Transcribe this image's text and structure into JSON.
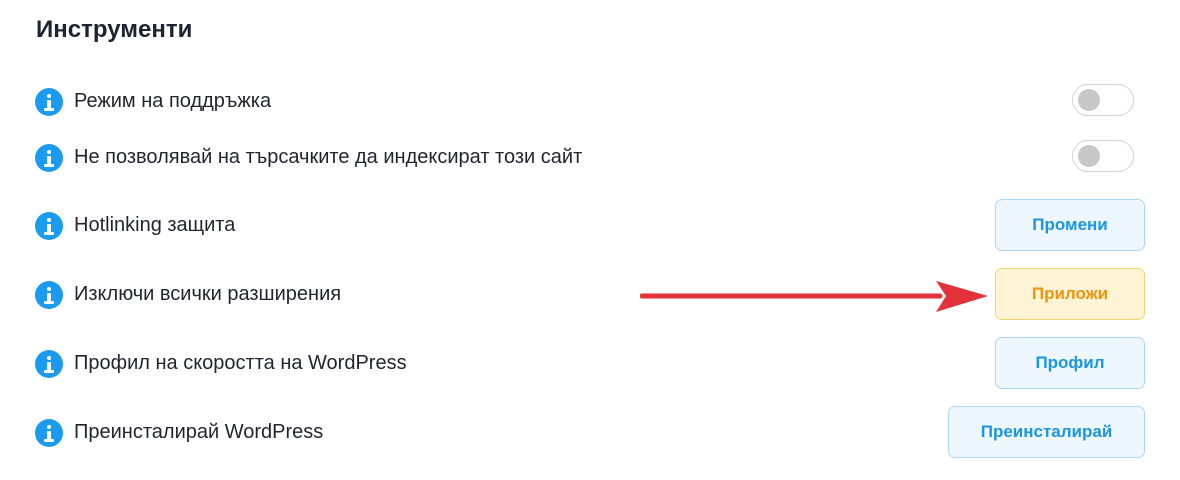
{
  "section": {
    "title": "Инструменти"
  },
  "rows": [
    {
      "label": "Режим на поддръжка",
      "control": "toggle",
      "toggle_on": false
    },
    {
      "label": "Не позволявай на търсачките да индексират този сайт",
      "control": "toggle",
      "toggle_on": false
    },
    {
      "label": "Hotlinking защита",
      "control": "button",
      "button_label": "Промени"
    },
    {
      "label": "Изключи всички разширения",
      "control": "button",
      "button_label": "Приложи"
    },
    {
      "label": "Профил на скоростта на WordPress",
      "control": "button",
      "button_label": "Профил"
    },
    {
      "label": "Преинсталирай WordPress",
      "control": "button",
      "button_label": "Преинсталирай"
    }
  ],
  "colors": {
    "info_icon": "#1a9bf0",
    "button_blue_text": "#1a96e3",
    "button_yellow_text": "#f0920b",
    "arrow": "#e3323a"
  },
  "icons": {
    "info": "info-icon",
    "annotation": "red-arrow"
  }
}
